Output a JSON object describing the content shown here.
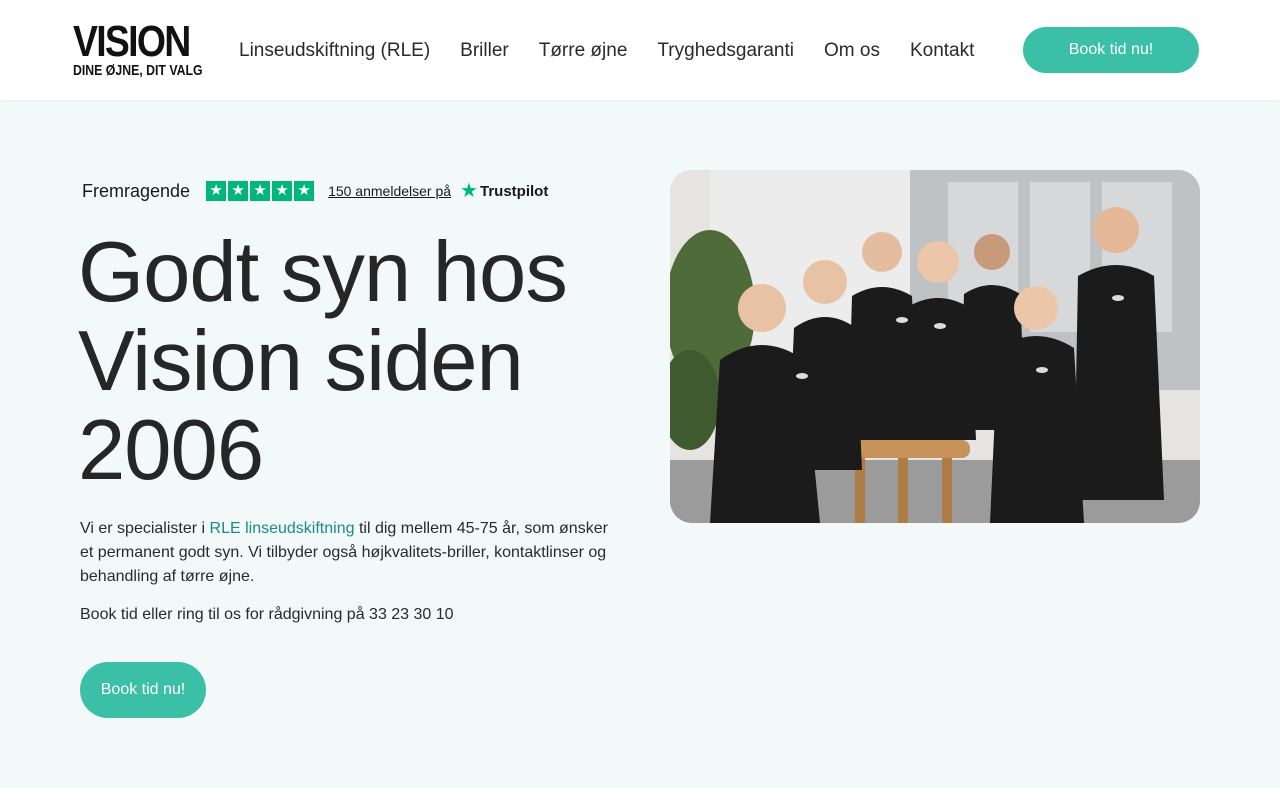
{
  "header": {
    "logo": {
      "main": "VISION",
      "tagline": "DINE ØJNE, DIT VALG"
    },
    "nav": [
      {
        "label": "Linseudskiftning (RLE)"
      },
      {
        "label": "Briller"
      },
      {
        "label": "Tørre øjne"
      },
      {
        "label": "Tryghedsgaranti"
      },
      {
        "label": "Om os"
      },
      {
        "label": "Kontakt"
      }
    ],
    "cta_label": "Book tid nu!"
  },
  "hero": {
    "trustpilot": {
      "rating_label": "Fremragende",
      "stars": 5,
      "reviews_link": "150 anmeldelser på",
      "brand": "Trustpilot"
    },
    "title": "Godt syn hos Vision siden 2006",
    "intro": {
      "before": "Vi er specialister i ",
      "link": "RLE linseudskiftning",
      "after": " til dig mellem 45-75 år, som ønsker et permanent godt syn. Vi tilbyder også højkvalitets-briller, kontaktlinser og behandling af tørre øjne."
    },
    "phone_text": "Book tid eller ring til os for rådgivning på 33 23 30 10",
    "cta_label": "Book tid nu!"
  },
  "colors": {
    "accent": "#3bbfa6",
    "trustpilot_green": "#00b67a",
    "hero_background": "#f3f9f9",
    "link": "#1a8a8a"
  }
}
